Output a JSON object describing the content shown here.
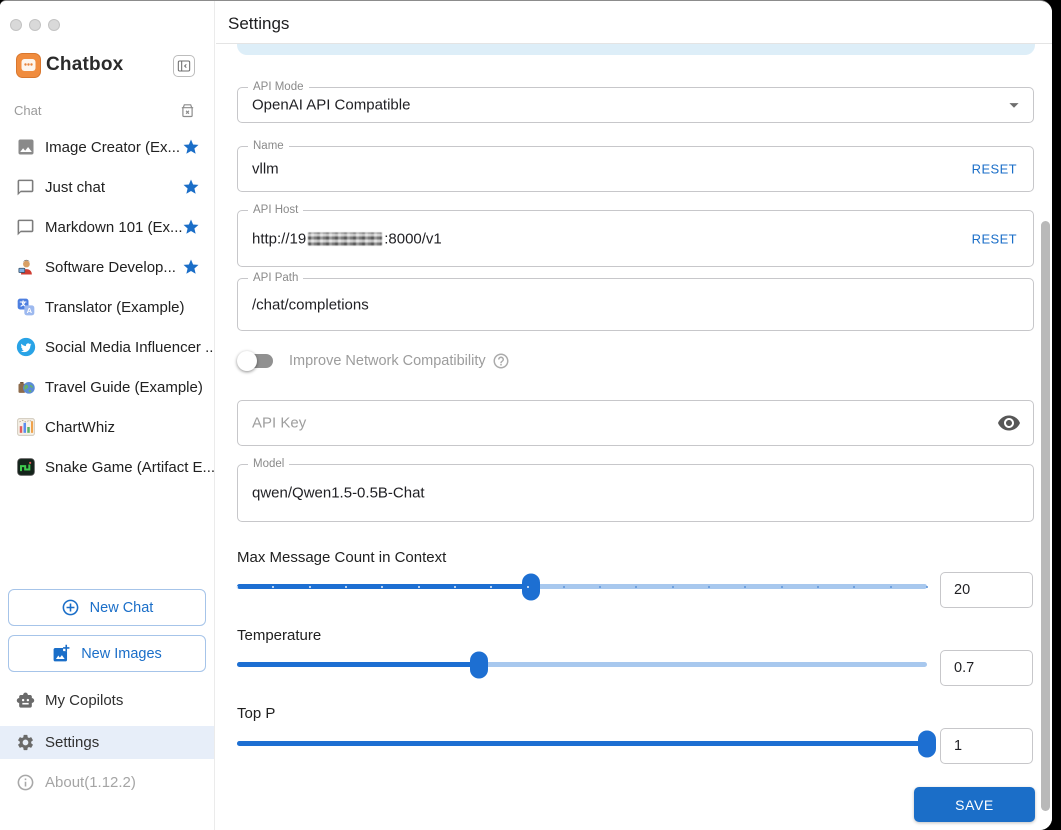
{
  "sidebar": {
    "brand": "Chatbox",
    "section_label": "Chat",
    "chats": [
      {
        "label": "Image Creator (Ex...",
        "icon": "image-icon",
        "starred": true
      },
      {
        "label": "Just chat",
        "icon": "chat-bubble-icon",
        "starred": true
      },
      {
        "label": "Markdown 101 (Ex...",
        "icon": "chat-bubble-icon",
        "starred": true
      },
      {
        "label": "Software Develop...",
        "icon": "developer-icon",
        "starred": true
      },
      {
        "label": "Translator (Example)",
        "icon": "translator-icon",
        "starred": false
      },
      {
        "label": "Social Media Influencer ...",
        "icon": "twitter-icon",
        "starred": false
      },
      {
        "label": "Travel Guide (Example)",
        "icon": "travel-icon",
        "starred": false
      },
      {
        "label": "ChartWhiz",
        "icon": "chart-icon",
        "starred": false
      },
      {
        "label": "Snake Game (Artifact E...",
        "icon": "snake-icon",
        "starred": false
      }
    ],
    "new_chat_label": "New Chat",
    "new_images_label": "New Images",
    "footer": [
      {
        "label": "My Copilots",
        "icon": "robot-icon",
        "selected": false,
        "dim": false
      },
      {
        "label": "Settings",
        "icon": "gear-icon",
        "selected": true,
        "dim": false
      },
      {
        "label": "About(1.12.2)",
        "icon": "info-icon",
        "selected": false,
        "dim": true
      }
    ]
  },
  "settings": {
    "title": "Settings",
    "api_mode": {
      "label": "API Mode",
      "value": "OpenAI API Compatible"
    },
    "name": {
      "label": "Name",
      "value": "vllm",
      "reset_label": "RESET"
    },
    "api_host": {
      "label": "API Host",
      "value_start": "http://19",
      "redacted": true,
      "value_end": ":8000/v1",
      "reset_label": "RESET"
    },
    "api_path": {
      "label": "API Path",
      "value": "/chat/completions"
    },
    "network_toggle": {
      "label": "Improve Network Compatibility",
      "state": "off"
    },
    "api_key": {
      "placeholder": "API Key"
    },
    "model": {
      "label": "Model",
      "value": "qwen/Qwen1.5-0.5B-Chat"
    },
    "sliders": [
      {
        "label": "Max Message Count in Context",
        "value": "20",
        "percent": 42.6,
        "marks": 20
      },
      {
        "label": "Temperature",
        "value": "0.7",
        "percent": 35,
        "marks": 0
      },
      {
        "label": "Top P",
        "value": "1",
        "percent": 100,
        "marks": 0
      }
    ],
    "save_label": "SAVE"
  },
  "colors": {
    "accent": "#1a6ec8",
    "slider_fill": "#1d6fd2",
    "slider_track": "#a8c8ee",
    "selected_item_bg": "#e7eef9",
    "tab_highlight": "#ddeef8"
  }
}
